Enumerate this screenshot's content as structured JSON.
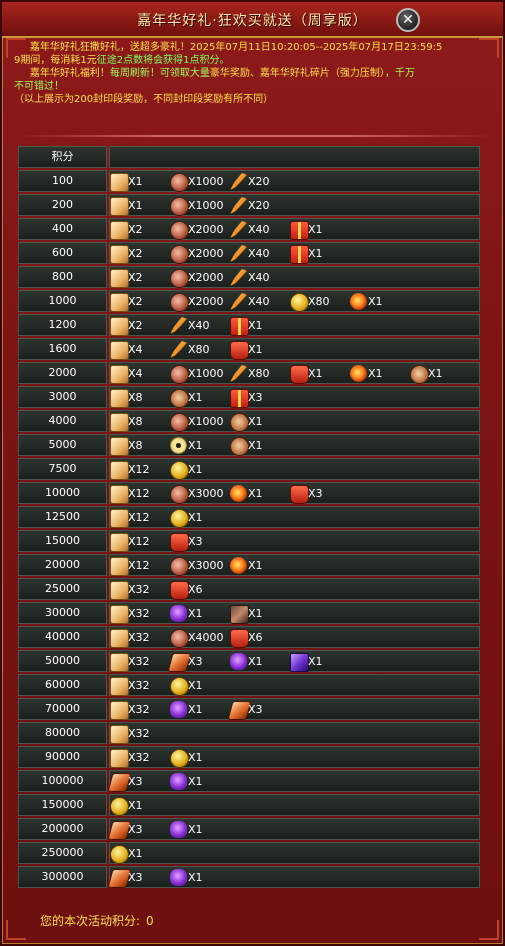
{
  "window": {
    "title": "嘉年华好礼·狂欢买就送（周享版）",
    "close_label": "✕"
  },
  "intro": {
    "line1a": "嘉年华好礼狂撒好礼，送超多豪礼！",
    "line1b": "2025年07月11日10:20:05--2025年07月17日23:59:5",
    "line2a": "9期间，每消耗1元",
    "line2b": "征途2点数将会获得1点积分。",
    "line3a": "嘉年华好礼福利！",
    "line3b": "每周刷新！可领取大量",
    "line3c": "豪华奖励、嘉年华好礼碎片（强力压制）",
    "line3d": "，千万",
    "line4": "不可错过！",
    "line5": "（以上展示为200封印段奖励，不同封印段奖励有所不同）"
  },
  "table": {
    "header": "积分",
    "rows": [
      {
        "points": "100",
        "items": [
          {
            "icon": "scroll",
            "qty": "X1"
          },
          {
            "icon": "shell",
            "qty": "X1000"
          },
          {
            "icon": "feather",
            "qty": "X20"
          }
        ]
      },
      {
        "points": "200",
        "items": [
          {
            "icon": "scroll",
            "qty": "X1"
          },
          {
            "icon": "shell",
            "qty": "X1000"
          },
          {
            "icon": "feather",
            "qty": "X20"
          }
        ]
      },
      {
        "points": "400",
        "items": [
          {
            "icon": "scroll",
            "qty": "X2"
          },
          {
            "icon": "shell",
            "qty": "X2000"
          },
          {
            "icon": "feather",
            "qty": "X40"
          },
          {
            "icon": "gift",
            "qty": "X1"
          }
        ]
      },
      {
        "points": "600",
        "items": [
          {
            "icon": "scroll",
            "qty": "X2"
          },
          {
            "icon": "shell",
            "qty": "X2000"
          },
          {
            "icon": "feather",
            "qty": "X40"
          },
          {
            "icon": "gift",
            "qty": "X1"
          }
        ]
      },
      {
        "points": "800",
        "items": [
          {
            "icon": "scroll",
            "qty": "X2"
          },
          {
            "icon": "shell",
            "qty": "X2000"
          },
          {
            "icon": "feather",
            "qty": "X40"
          }
        ]
      },
      {
        "points": "1000",
        "items": [
          {
            "icon": "scroll",
            "qty": "X2"
          },
          {
            "icon": "shell",
            "qty": "X2000"
          },
          {
            "icon": "feather",
            "qty": "X40"
          },
          {
            "icon": "gold",
            "qty": "X80"
          },
          {
            "icon": "flame",
            "qty": "X1"
          }
        ]
      },
      {
        "points": "1200",
        "items": [
          {
            "icon": "scroll",
            "qty": "X2"
          },
          {
            "icon": "feather",
            "qty": "X40"
          },
          {
            "icon": "gift",
            "qty": "X1"
          }
        ]
      },
      {
        "points": "1600",
        "items": [
          {
            "icon": "scroll",
            "qty": "X4"
          },
          {
            "icon": "feather",
            "qty": "X80"
          },
          {
            "icon": "bag",
            "qty": "X1"
          }
        ]
      },
      {
        "points": "2000",
        "items": [
          {
            "icon": "scroll",
            "qty": "X4"
          },
          {
            "icon": "shell",
            "qty": "X1000"
          },
          {
            "icon": "feather",
            "qty": "X80"
          },
          {
            "icon": "bag",
            "qty": "X1"
          },
          {
            "icon": "flame",
            "qty": "X1"
          },
          {
            "icon": "cookie",
            "qty": "X1"
          }
        ]
      },
      {
        "points": "3000",
        "items": [
          {
            "icon": "scroll",
            "qty": "X8"
          },
          {
            "icon": "cookie",
            "qty": "X1"
          },
          {
            "icon": "gift",
            "qty": "X3"
          }
        ]
      },
      {
        "points": "4000",
        "items": [
          {
            "icon": "scroll",
            "qty": "X8"
          },
          {
            "icon": "shell",
            "qty": "X1000"
          },
          {
            "icon": "cookie",
            "qty": "X1"
          }
        ]
      },
      {
        "points": "5000",
        "items": [
          {
            "icon": "scroll",
            "qty": "X8"
          },
          {
            "icon": "eye",
            "qty": "X1"
          },
          {
            "icon": "cookie",
            "qty": "X1"
          }
        ]
      },
      {
        "points": "7500",
        "items": [
          {
            "icon": "scroll",
            "qty": "X12"
          },
          {
            "icon": "gold",
            "qty": "X1"
          }
        ]
      },
      {
        "points": "10000",
        "items": [
          {
            "icon": "scroll",
            "qty": "X12"
          },
          {
            "icon": "shell",
            "qty": "X3000"
          },
          {
            "icon": "flame",
            "qty": "X1"
          },
          {
            "icon": "bag",
            "qty": "X3"
          }
        ]
      },
      {
        "points": "12500",
        "items": [
          {
            "icon": "scroll",
            "qty": "X12"
          },
          {
            "icon": "gold",
            "qty": "X1"
          }
        ]
      },
      {
        "points": "15000",
        "items": [
          {
            "icon": "scroll",
            "qty": "X12"
          },
          {
            "icon": "bag",
            "qty": "X3"
          }
        ]
      },
      {
        "points": "20000",
        "items": [
          {
            "icon": "scroll",
            "qty": "X12"
          },
          {
            "icon": "shell",
            "qty": "X3000"
          },
          {
            "icon": "flame",
            "qty": "X1"
          }
        ]
      },
      {
        "points": "25000",
        "items": [
          {
            "icon": "scroll",
            "qty": "X32"
          },
          {
            "icon": "bag",
            "qty": "X6"
          }
        ]
      },
      {
        "points": "30000",
        "items": [
          {
            "icon": "scroll",
            "qty": "X32"
          },
          {
            "icon": "purple",
            "qty": "X1"
          },
          {
            "icon": "dragon",
            "qty": "X1"
          }
        ]
      },
      {
        "points": "40000",
        "items": [
          {
            "icon": "scroll",
            "qty": "X32"
          },
          {
            "icon": "shell",
            "qty": "X4000"
          },
          {
            "icon": "bag",
            "qty": "X6"
          }
        ]
      },
      {
        "points": "50000",
        "items": [
          {
            "icon": "scroll",
            "qty": "X32"
          },
          {
            "icon": "tag",
            "qty": "X3"
          },
          {
            "icon": "purple",
            "qty": "X1"
          },
          {
            "icon": "purpleb",
            "qty": "X1"
          }
        ]
      },
      {
        "points": "60000",
        "items": [
          {
            "icon": "scroll",
            "qty": "X32"
          },
          {
            "icon": "gold",
            "qty": "X1"
          }
        ]
      },
      {
        "points": "70000",
        "items": [
          {
            "icon": "scroll",
            "qty": "X32"
          },
          {
            "icon": "purple",
            "qty": "X1"
          },
          {
            "icon": "tag",
            "qty": "X3"
          }
        ]
      },
      {
        "points": "80000",
        "items": [
          {
            "icon": "scroll",
            "qty": "X32"
          }
        ]
      },
      {
        "points": "90000",
        "items": [
          {
            "icon": "scroll",
            "qty": "X32"
          },
          {
            "icon": "gold",
            "qty": "X1"
          }
        ]
      },
      {
        "points": "100000",
        "items": [
          {
            "icon": "tag",
            "qty": "X3"
          },
          {
            "icon": "purple",
            "qty": "X1"
          }
        ]
      },
      {
        "points": "150000",
        "items": [
          {
            "icon": "gold",
            "qty": "X1"
          }
        ]
      },
      {
        "points": "200000",
        "items": [
          {
            "icon": "tag",
            "qty": "X3"
          },
          {
            "icon": "purple",
            "qty": "X1"
          }
        ]
      },
      {
        "points": "250000",
        "items": [
          {
            "icon": "gold",
            "qty": "X1"
          }
        ]
      },
      {
        "points": "300000",
        "items": [
          {
            "icon": "tag",
            "qty": "X3"
          },
          {
            "icon": "purple",
            "qty": "X1"
          }
        ]
      }
    ]
  },
  "footer": {
    "label": "您的本次活动积分:",
    "value": "0"
  }
}
